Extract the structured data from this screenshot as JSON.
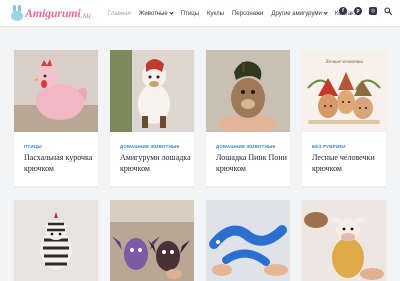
{
  "site": {
    "logo_text": "Amigurumi",
    "logo_tld": ".su"
  },
  "nav": {
    "items": [
      {
        "label": "Главная",
        "active": true,
        "dropdown": false
      },
      {
        "label": "Животные",
        "active": false,
        "dropdown": true
      },
      {
        "label": "Птицы",
        "active": false,
        "dropdown": false
      },
      {
        "label": "Куклы",
        "active": false,
        "dropdown": false
      },
      {
        "label": "Персонажи",
        "active": false,
        "dropdown": false
      },
      {
        "label": "Другие амигуруми",
        "active": false,
        "dropdown": true
      },
      {
        "label": "Контакты",
        "active": false,
        "dropdown": false
      }
    ]
  },
  "socials": [
    {
      "icon": "facebook-icon",
      "glyph": "f"
    },
    {
      "icon": "pinterest-icon",
      "glyph": "p"
    },
    {
      "icon": "instagram-icon",
      "glyph": "◎"
    },
    {
      "icon": "search-icon",
      "glyph": ""
    }
  ],
  "posts": [
    {
      "category": "ПТИЦЫ",
      "title": "Пасхальная курочка крючком",
      "image": "pink-crochet-hen"
    },
    {
      "category": "ДОМАШНИЕ ЖИВОТНЫЕ",
      "title": "Амигуруми лошадка крючком",
      "image": "white-crochet-horse"
    },
    {
      "category": "ДОМАШНИЕ ЖИВОТНЫЕ",
      "title": "Лошадка Пинк Пони крючком",
      "image": "brown-crochet-pony"
    },
    {
      "category": "БЕЗ РУБРИКИ",
      "title": "Лесные человечки крючком",
      "image": "forest-people-dolls",
      "image_caption": "Лесные человечки"
    },
    {
      "image": "crochet-zebra"
    },
    {
      "image": "purple-crochet-bats"
    },
    {
      "image": "blue-crochet-dinosaur"
    },
    {
      "image": "crochet-cow-toy"
    }
  ],
  "colors": {
    "accent": "#3182ce",
    "text": "#1a202c",
    "background": "#f3f4f6",
    "logo": "#e86a9a"
  }
}
